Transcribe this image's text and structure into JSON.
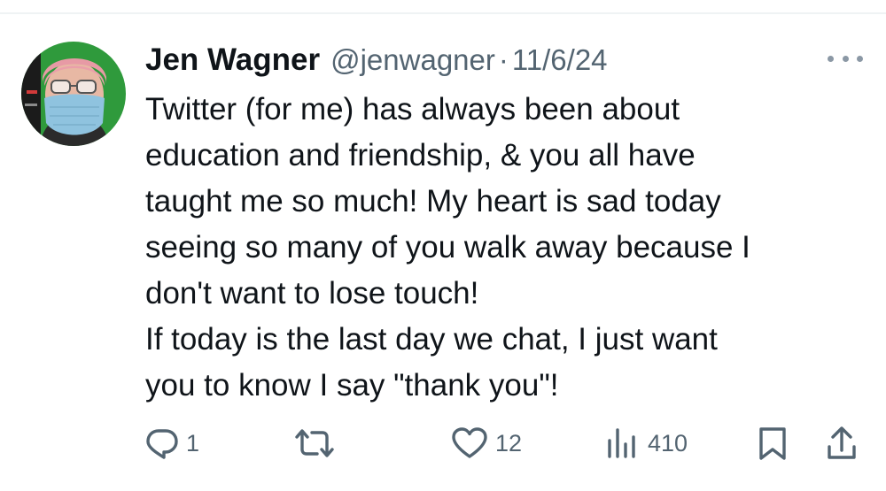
{
  "tweet": {
    "author": {
      "display_name": "Jen Wagner",
      "handle": "@jenwagner",
      "avatar_icon": "user-avatar"
    },
    "separator": "·",
    "date": "11/6/24",
    "text_lines": [
      "Twitter (for me) has always been about",
      "education and friendship, & you all have",
      "taught me so much! My heart is sad today",
      "seeing so many of you walk away because I",
      "don't want to lose touch!",
      "If today is the last day we chat, I just want",
      "you to know I say \"thank you\"!"
    ]
  },
  "actions": {
    "reply": {
      "icon": "reply-icon",
      "count": "1"
    },
    "retweet": {
      "icon": "retweet-icon",
      "count": ""
    },
    "like": {
      "icon": "heart-icon",
      "count": "12"
    },
    "views": {
      "icon": "views-icon",
      "count": "410"
    },
    "bookmark": {
      "icon": "bookmark-icon"
    },
    "share": {
      "icon": "share-icon"
    }
  },
  "colors": {
    "text": "#0f1419",
    "secondary": "#536471",
    "divider": "#eff3f4"
  }
}
